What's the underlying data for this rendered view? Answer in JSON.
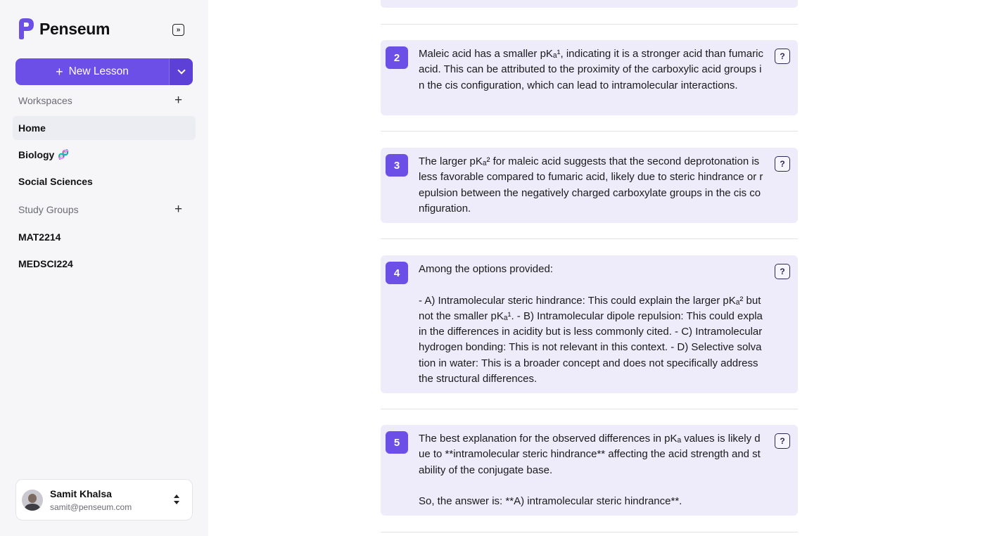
{
  "brand": {
    "name": "Penseum"
  },
  "sidebar": {
    "new_lesson_label": "New Lesson",
    "workspaces_label": "Workspaces",
    "workspaces": [
      {
        "label": "Home",
        "active": true
      },
      {
        "label": "Biology",
        "emoji": "🧬"
      },
      {
        "label": "Social Sciences"
      }
    ],
    "study_groups_label": "Study Groups",
    "study_groups": [
      {
        "label": "MAT2214"
      },
      {
        "label": "MEDSCI224"
      }
    ]
  },
  "user": {
    "name": "Samit Khalsa",
    "email": "samit@penseum.com"
  },
  "steps": [
    {
      "number": "2",
      "text": "Maleic acid has a smaller pKₐ¹, indicating it is a stronger acid than fumaric acid. This can be attributed to the proximity of the carboxylic acid groups in the cis configuration, which can lead to intramolecular interactions."
    },
    {
      "number": "3",
      "text": "The larger pKₐ² for maleic acid suggests that the second deprotonation is less favorable compared to fumaric acid, likely due to steric hindrance or repulsion between the negatively charged carboxylate groups in the cis configuration."
    },
    {
      "number": "4",
      "text": "Among the options provided:\n\n- A) Intramolecular steric hindrance: This could explain the larger pKₐ² but not the smaller pKₐ¹. - B) Intramolecular dipole repulsion: This could explain the differences in acidity but is less commonly cited. - C) Intramolecular hydrogen bonding: This is not relevant in this context. - D) Selective solvation in water: This is a broader concept and does not specifically address the structural differences."
    },
    {
      "number": "5",
      "text": "The best explanation for the observed differences in pKₐ values is likely due to **intramolecular steric hindrance** affecting the acid strength and stability of the conjugate base.\n\nSo, the answer is: **A) intramolecular steric hindrance**."
    }
  ],
  "help_label": "?",
  "colors": {
    "accent": "#6b4fe6",
    "card_bg": "#eeecfb",
    "sidebar_bg": "#f6f6f9"
  }
}
